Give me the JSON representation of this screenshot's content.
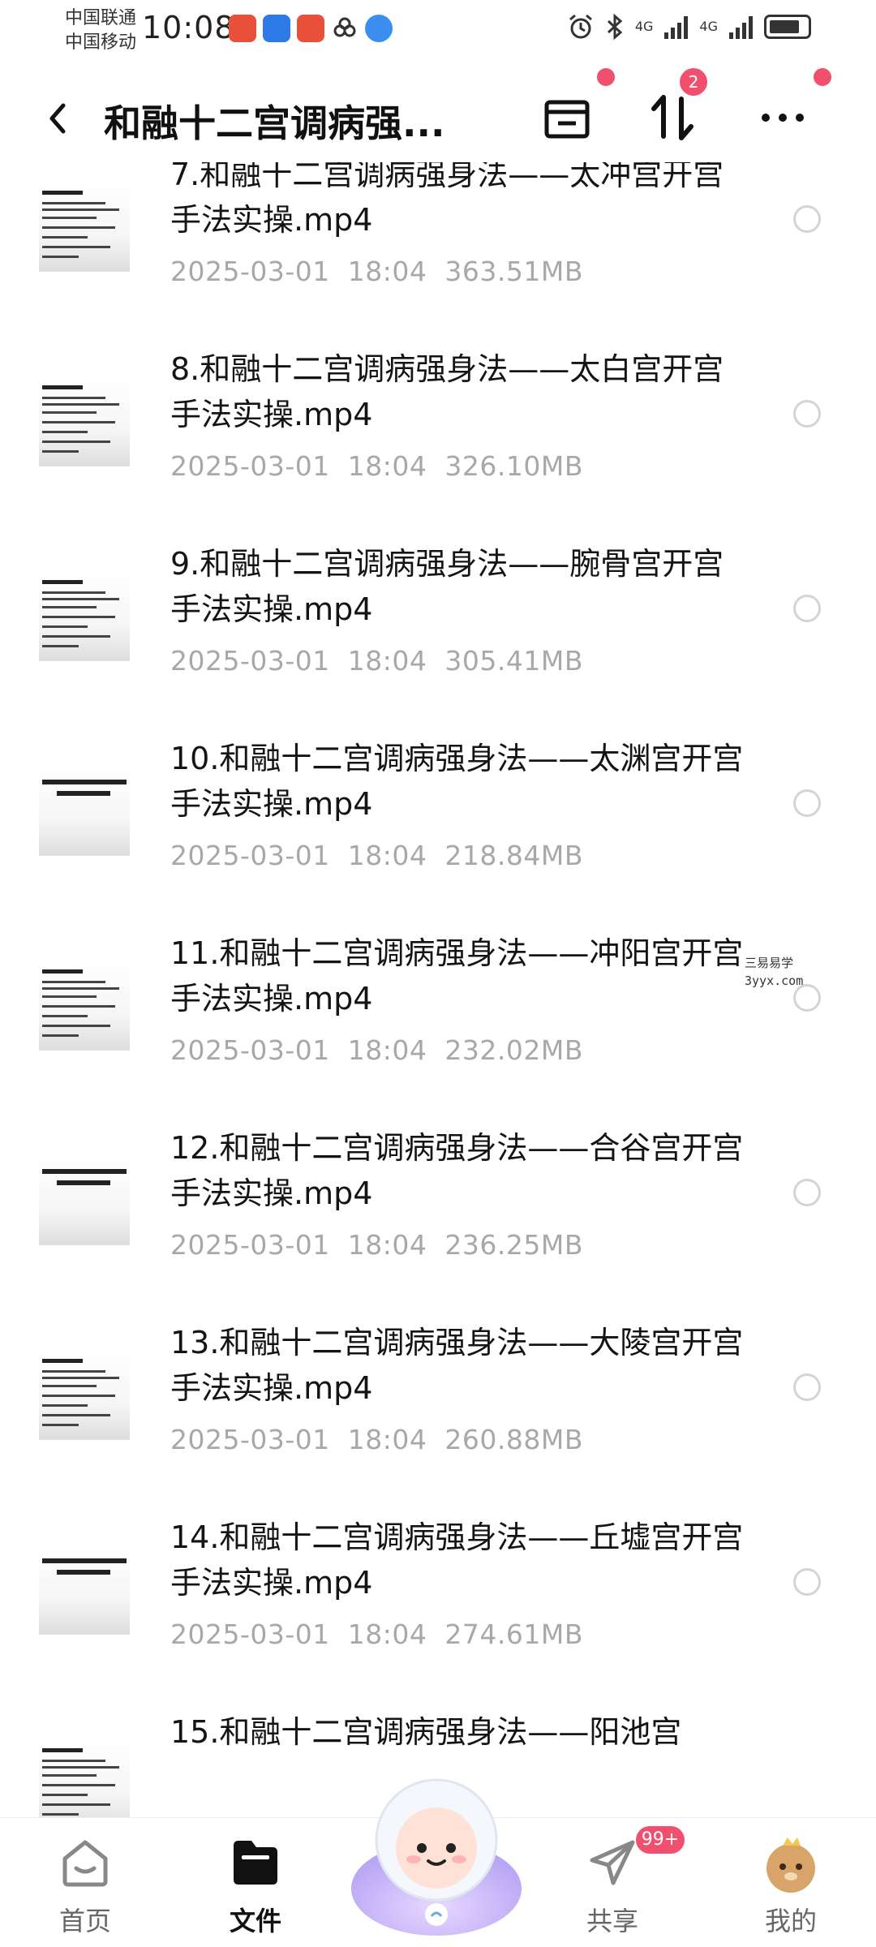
{
  "status_bar": {
    "carrier1": "中国联通",
    "carrier2": "中国移动",
    "time": "10:08",
    "net1": "4G",
    "net2": "4G"
  },
  "header": {
    "title": "和融十二宫调病强...",
    "transfer_badge": "2"
  },
  "files": [
    {
      "name": "7.和融十二宫调病强身法——太冲宫开宫手法实操.mp4",
      "date": "2025-03-01",
      "time": "18:04",
      "size": "363.51MB",
      "thumb": "text"
    },
    {
      "name": "8.和融十二宫调病强身法——太白宫开宫手法实操.mp4",
      "date": "2025-03-01",
      "time": "18:04",
      "size": "326.10MB",
      "thumb": "text"
    },
    {
      "name": "9.和融十二宫调病强身法——腕骨宫开宫手法实操.mp4",
      "date": "2025-03-01",
      "time": "18:04",
      "size": "305.41MB",
      "thumb": "text"
    },
    {
      "name": "10.和融十二宫调病强身法——太渊宫开宫手法实操.mp4",
      "date": "2025-03-01",
      "time": "18:04",
      "size": "218.84MB",
      "thumb": "title"
    },
    {
      "name": "11.和融十二宫调病强身法——冲阳宫开宫手法实操.mp4",
      "date": "2025-03-01",
      "time": "18:04",
      "size": "232.02MB",
      "thumb": "text"
    },
    {
      "name": "12.和融十二宫调病强身法——合谷宫开宫手法实操.mp4",
      "date": "2025-03-01",
      "time": "18:04",
      "size": "236.25MB",
      "thumb": "title"
    },
    {
      "name": "13.和融十二宫调病强身法——大陵宫开宫手法实操.mp4",
      "date": "2025-03-01",
      "time": "18:04",
      "size": "260.88MB",
      "thumb": "text"
    },
    {
      "name": "14.和融十二宫调病强身法——丘墟宫开宫手法实操.mp4",
      "date": "2025-03-01",
      "time": "18:04",
      "size": "274.61MB",
      "thumb": "title"
    },
    {
      "name": "15.和融十二宫调病强身法——阳池宫",
      "date": "",
      "time": "",
      "size": "",
      "thumb": "text"
    }
  ],
  "watermark": {
    "line1": "三易易学",
    "line2": "3yyx.com"
  },
  "bottom_nav": {
    "home": "首页",
    "files": "文件",
    "share": "共享",
    "share_badge": "99+",
    "mine": "我的"
  },
  "colors": {
    "accent_red": "#f0506e",
    "meta_gray": "#a8a8a8"
  }
}
